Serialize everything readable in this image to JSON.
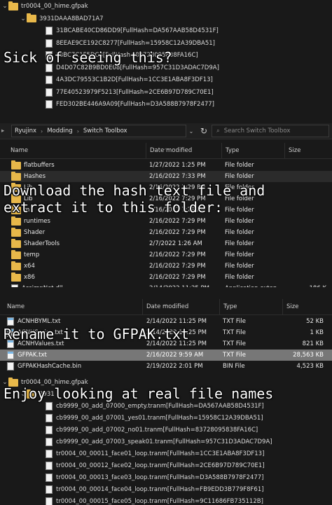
{
  "panel1": {
    "rows": [
      {
        "chev": "⌄",
        "icon": "folder",
        "text": "tr0004_00_hime.gfpak"
      },
      {
        "chev": "⌄",
        "icon": "folder",
        "text": "3931DAAA8BAD71A7"
      },
      {
        "chev": "",
        "icon": "file",
        "text": "31BCABE40CD86DD9[FullHash=DA567AAB58D4531F]"
      },
      {
        "chev": "",
        "icon": "file",
        "text": "8EEAE9CE192C8277[FullHash=15958C12A39DBA51]"
      },
      {
        "chev": "",
        "icon": "file",
        "text": "F8BC7C1F5DC8[FullHash=83728095838FA16C]"
      },
      {
        "chev": "",
        "icon": "file",
        "text": "D4D07C82B9BD0E08[FullHash=957C31D3ADAC7D9A]"
      },
      {
        "chev": "",
        "icon": "file",
        "text": "4A3DC79553C1B2D[FullHash=1CC3E1ABA8F3DF13]"
      },
      {
        "chev": "",
        "icon": "file",
        "text": "77E40523979F5213[FullHash=2CE6B97D789C70E1]"
      },
      {
        "chev": "",
        "icon": "file",
        "text": "FED302BE446A9A09[FullHash=D3A588B7978F2477]"
      }
    ]
  },
  "captions": {
    "c1": "Sick of seeing this?",
    "c2": "Download the hash text file and extract it to this folder:",
    "c3": "Rename it to GFPAK.txt",
    "c4": "Enjoy looking at real file names"
  },
  "explorer": {
    "breadcrumbs": [
      "Ryujinx",
      "Modding",
      "Switch Toolbox"
    ],
    "search_placeholder": "Search Switch Toolbox",
    "columns": {
      "name": "Name",
      "date": "Date modified",
      "type": "Type",
      "size": "Size"
    },
    "rows": [
      {
        "icon": "folder",
        "name": "flatbuffers",
        "date": "1/27/2022 1:25 PM",
        "type": "File folder",
        "size": "",
        "state": ""
      },
      {
        "icon": "folder",
        "name": "Hashes",
        "date": "2/16/2022 7:33 PM",
        "type": "File folder",
        "size": "",
        "state": "hl"
      },
      {
        "icon": "folder",
        "name": "Lib",
        "date": "2/16/2022 7:29 PM",
        "type": "File folder",
        "size": "",
        "state": ""
      },
      {
        "icon": "folder",
        "name": "Lib",
        "date": "2/16/2022 7:29 PM",
        "type": "File folder",
        "size": "",
        "state": ""
      },
      {
        "icon": "folder",
        "name": "m",
        "date": "2/16/2022 7:29 PM",
        "type": "File folder",
        "size": "",
        "state": ""
      },
      {
        "icon": "folder",
        "name": "runtimes",
        "date": "2/16/2022 7:29 PM",
        "type": "File folder",
        "size": "",
        "state": ""
      },
      {
        "icon": "folder",
        "name": "Shader",
        "date": "2/16/2022 7:29 PM",
        "type": "File folder",
        "size": "",
        "state": ""
      },
      {
        "icon": "folder",
        "name": "ShaderTools",
        "date": "2/7/2022 1:26 AM",
        "type": "File folder",
        "size": "",
        "state": ""
      },
      {
        "icon": "folder",
        "name": "temp",
        "date": "2/16/2022 7:29 PM",
        "type": "File folder",
        "size": "",
        "state": ""
      },
      {
        "icon": "folder",
        "name": "x64",
        "date": "2/16/2022 7:29 PM",
        "type": "File folder",
        "size": "",
        "state": ""
      },
      {
        "icon": "folder",
        "name": "x86",
        "date": "2/16/2022 7:29 PM",
        "type": "File folder",
        "size": "",
        "state": ""
      },
      {
        "icon": "dll",
        "name": "AssimpNet.dll",
        "date": "2/14/2022 11:25 PM",
        "type": "Application exten...",
        "size": "186 K",
        "state": ""
      }
    ]
  },
  "hashes": {
    "columns": {
      "name": "Name",
      "date": "Date modified",
      "type": "Type",
      "size": "Size"
    },
    "rows": [
      {
        "icon": "notepad",
        "name": "ACNHBYML.txt",
        "date": "2/14/2022 11:25 PM",
        "type": "TXT File",
        "size": "52 KB",
        "state": ""
      },
      {
        "icon": "notepad",
        "name": "ACNHSeries.txt",
        "date": "2/14/2022 11:25 PM",
        "type": "TXT File",
        "size": "1 KB",
        "state": ""
      },
      {
        "icon": "notepad",
        "name": "ACNHValues.txt",
        "date": "2/14/2022 11:25 PM",
        "type": "TXT File",
        "size": "821 KB",
        "state": ""
      },
      {
        "icon": "notepad",
        "name": "GFPAK.txt",
        "date": "2/16/2022 9:59 AM",
        "type": "TXT File",
        "size": "28,563 KB",
        "state": "sel"
      },
      {
        "icon": "file",
        "name": "GFPAKHashCache.bin",
        "date": "2/19/2022 2:01 PM",
        "type": "BIN File",
        "size": "4,523 KB",
        "state": ""
      }
    ]
  },
  "panel4": {
    "rows": [
      {
        "chev": "⌄",
        "icon": "folder",
        "text": "tr0004_00_hime.gfpak"
      },
      {
        "chev": "⌄",
        "icon": "folder",
        "text": "3931"
      },
      {
        "chev": "",
        "icon": "file",
        "text": "cb9999_00_add_07000_empty.tranm[FullHash=DA567AAB58D4531F]"
      },
      {
        "chev": "",
        "icon": "file",
        "text": "cb9999_00_add_07001_yes01.tranm[FullHash=15958C12A39DBA51]"
      },
      {
        "chev": "",
        "icon": "file",
        "text": "cb9999_00_add_07002_no01.tranm[FullHash=83728095838FA16C]"
      },
      {
        "chev": "",
        "icon": "file",
        "text": "cb9999_00_add_07003_speak01.tranm[FullHash=957C31D3ADAC7D9A]"
      },
      {
        "chev": "",
        "icon": "file",
        "text": "tr0004_00_00011_face01_loop.tranm[FullHash=1CC3E1ABA8F3DF13]"
      },
      {
        "chev": "",
        "icon": "file",
        "text": "tr0004_00_00012_face02_loop.tranm[FullHash=2CE6B97D789C70E1]"
      },
      {
        "chev": "",
        "icon": "file",
        "text": "tr0004_00_00013_face03_loop.tranm[FullHash=D3A588B7978F2477]"
      },
      {
        "chev": "",
        "icon": "file",
        "text": "tr0004_00_00014_face04_loop.tranm[FullHash=FB9EDD3B779F8F61]"
      },
      {
        "chev": "",
        "icon": "file",
        "text": "tr0004_00_00015_face05_loop.tranm[FullHash=9C11686FB735112B]"
      }
    ]
  }
}
